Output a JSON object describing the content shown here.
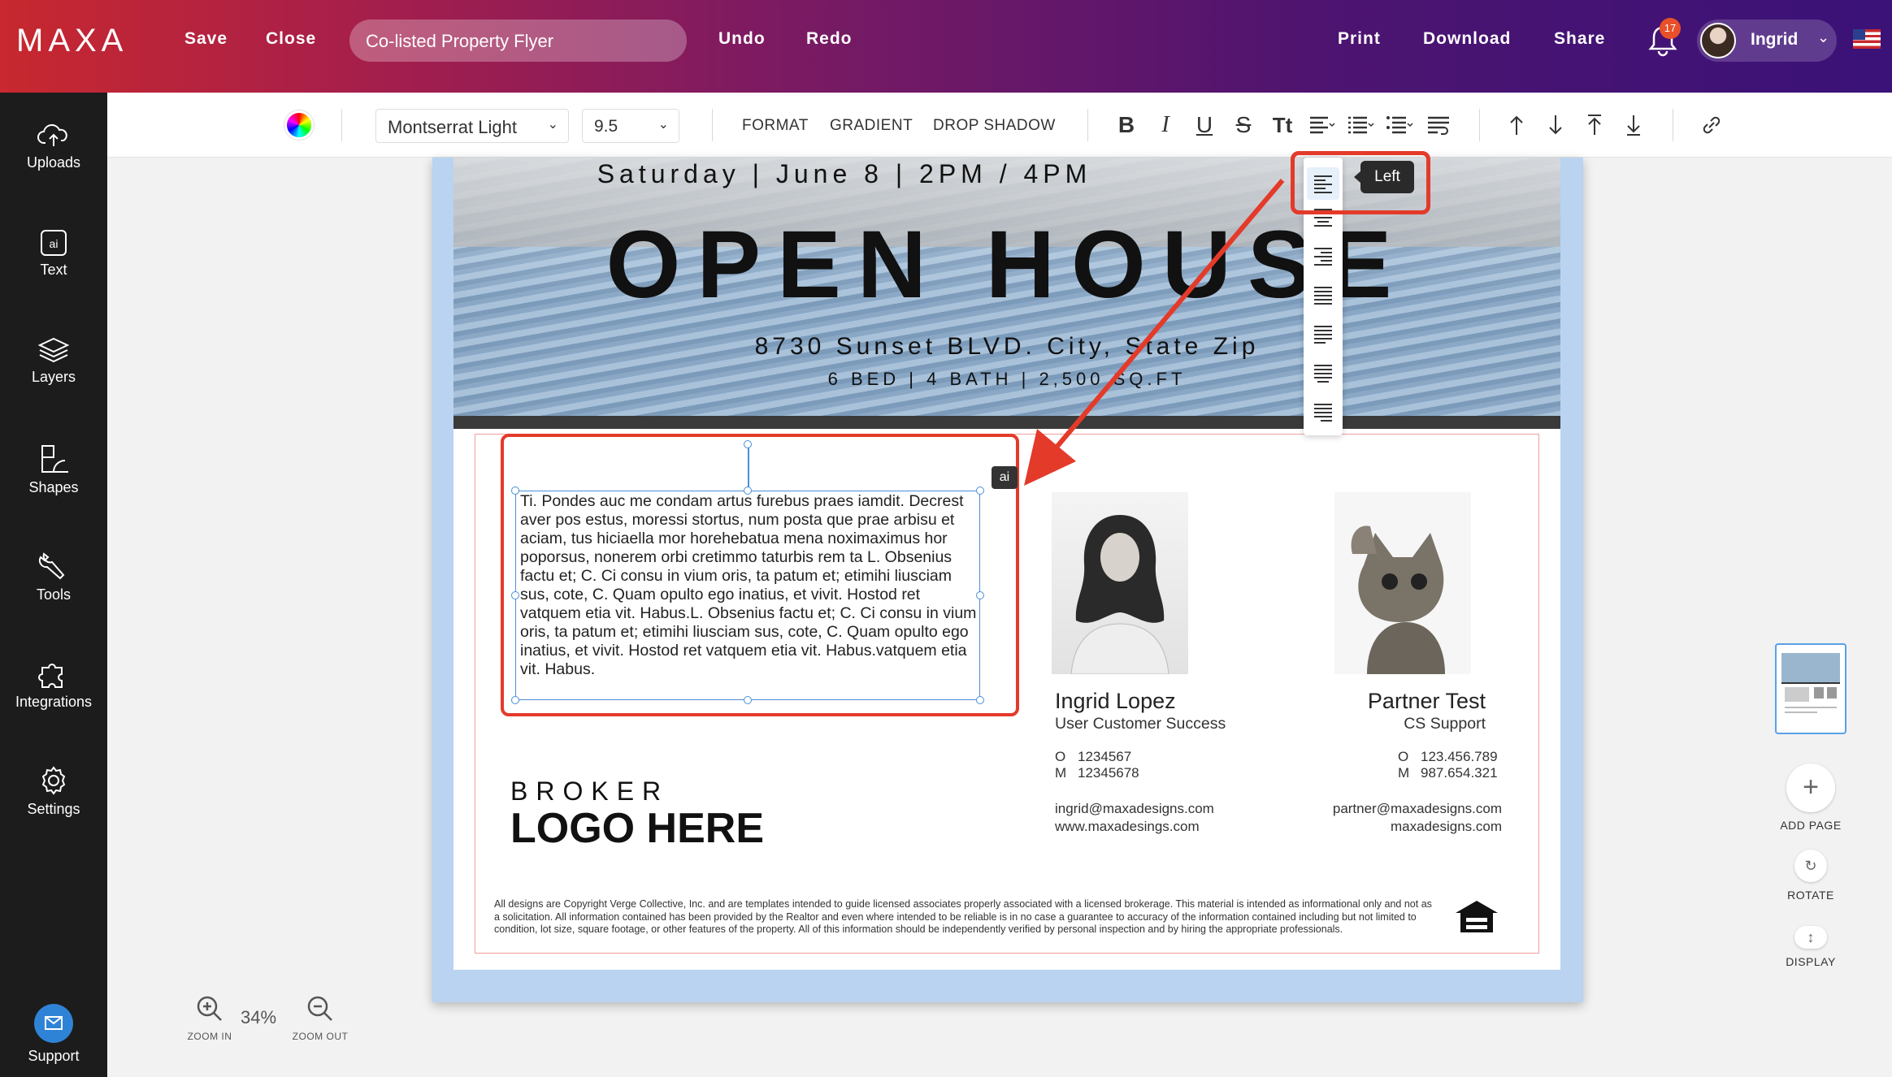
{
  "topbar": {
    "brand": "MAXA",
    "save": "Save",
    "close": "Close",
    "doc_title": "Co-listed Property Flyer",
    "undo": "Undo",
    "redo": "Redo",
    "print": "Print",
    "download": "Download",
    "share": "Share",
    "notifications": "17",
    "user": "Ingrid"
  },
  "sidebar": {
    "items": [
      {
        "label": "Uploads",
        "icon": "cloud-upload-icon"
      },
      {
        "label": "Text",
        "icon": "ai-text-icon"
      },
      {
        "label": "Layers",
        "icon": "layers-icon"
      },
      {
        "label": "Shapes",
        "icon": "shapes-icon"
      },
      {
        "label": "Tools",
        "icon": "wrench-icon"
      },
      {
        "label": "Integrations",
        "icon": "puzzle-icon"
      },
      {
        "label": "Settings",
        "icon": "gear-icon"
      }
    ],
    "support": "Support"
  },
  "toolbar": {
    "font": "Montserrat Light",
    "size": "9.5",
    "format": "FORMAT",
    "gradient": "GRADIENT",
    "drop_shadow": "DROP SHADOW",
    "bold": "B",
    "italic": "I",
    "underline": "U",
    "strike": "S",
    "case": "Tt"
  },
  "flyer": {
    "date": "Saturday | June 8 | 2PM / 4PM",
    "headline": "OPEN HOUSE",
    "address": "8730 Sunset BLVD. City, State Zip",
    "specs": "6 BED | 4 BATH | 2,500 SQ.FT",
    "body": "Ti. Pondes auc me condam artus furebus praes iamdit. Decrest aver pos estus, moressi stortus, num posta que prae arbisu et aciam, tus hiciaella mor horehebatua mena noximaximus hor poporsus, nonerem orbi cretimmo taturbis rem ta L. Obsenius factu et; C. Ci consu in vium oris, ta patum et; etimihi liusciam sus, cote, C. Quam opulto ego inatius, et vivit. Hostod ret vatquem etia vit. Habus.L. Obsenius factu et; C. Ci consu in vium oris, ta patum et; etimihi liusciam sus, cote, C. Quam opulto ego inatius, et vivit. Hostod ret vatquem etia vit. Habus.vatquem etia vit. Habus.",
    "ai_tag": "ai",
    "agent1": {
      "name": "Ingrid Lopez",
      "title": "User Customer Success",
      "o_label": "O",
      "o": "1234567",
      "m_label": "M",
      "m": "12345678",
      "email": "ingrid@maxadesigns.com",
      "web": "www.maxadesings.com"
    },
    "agent2": {
      "name": "Partner Test",
      "title": "CS Support",
      "o_label": "O",
      "o": "123.456.789",
      "m_label": "M",
      "m": "987.654.321",
      "email": "partner@maxadesigns.com",
      "web": "maxadesigns.com"
    },
    "broker_top": "BROKER",
    "broker_logo": "LOGO HERE",
    "disclaimer": "All designs are Copyright Verge Collective, Inc. and are templates intended to guide licensed associates properly associated with a licensed brokerage. This material is intended as informational only and not as a solicitation. All information contained has been provided by the Realtor and even where intended to be reliable is in no case a guarantee to accuracy of the information contained including but not limited to condition, lot size, square footage, or other features of the property. All of this information should be independently verified by personal inspection and by hiring the appropriate professionals."
  },
  "align_tooltip": "Left",
  "rail": {
    "add_page": "ADD PAGE",
    "rotate": "ROTATE",
    "display": "DISPLAY"
  },
  "zoom": {
    "in": "ZOOM IN",
    "value": "34%",
    "out": "ZOOM OUT"
  },
  "colors": {
    "highlight": "#e43a2a",
    "selection": "#4a8fd8",
    "support": "#2f83d6"
  }
}
